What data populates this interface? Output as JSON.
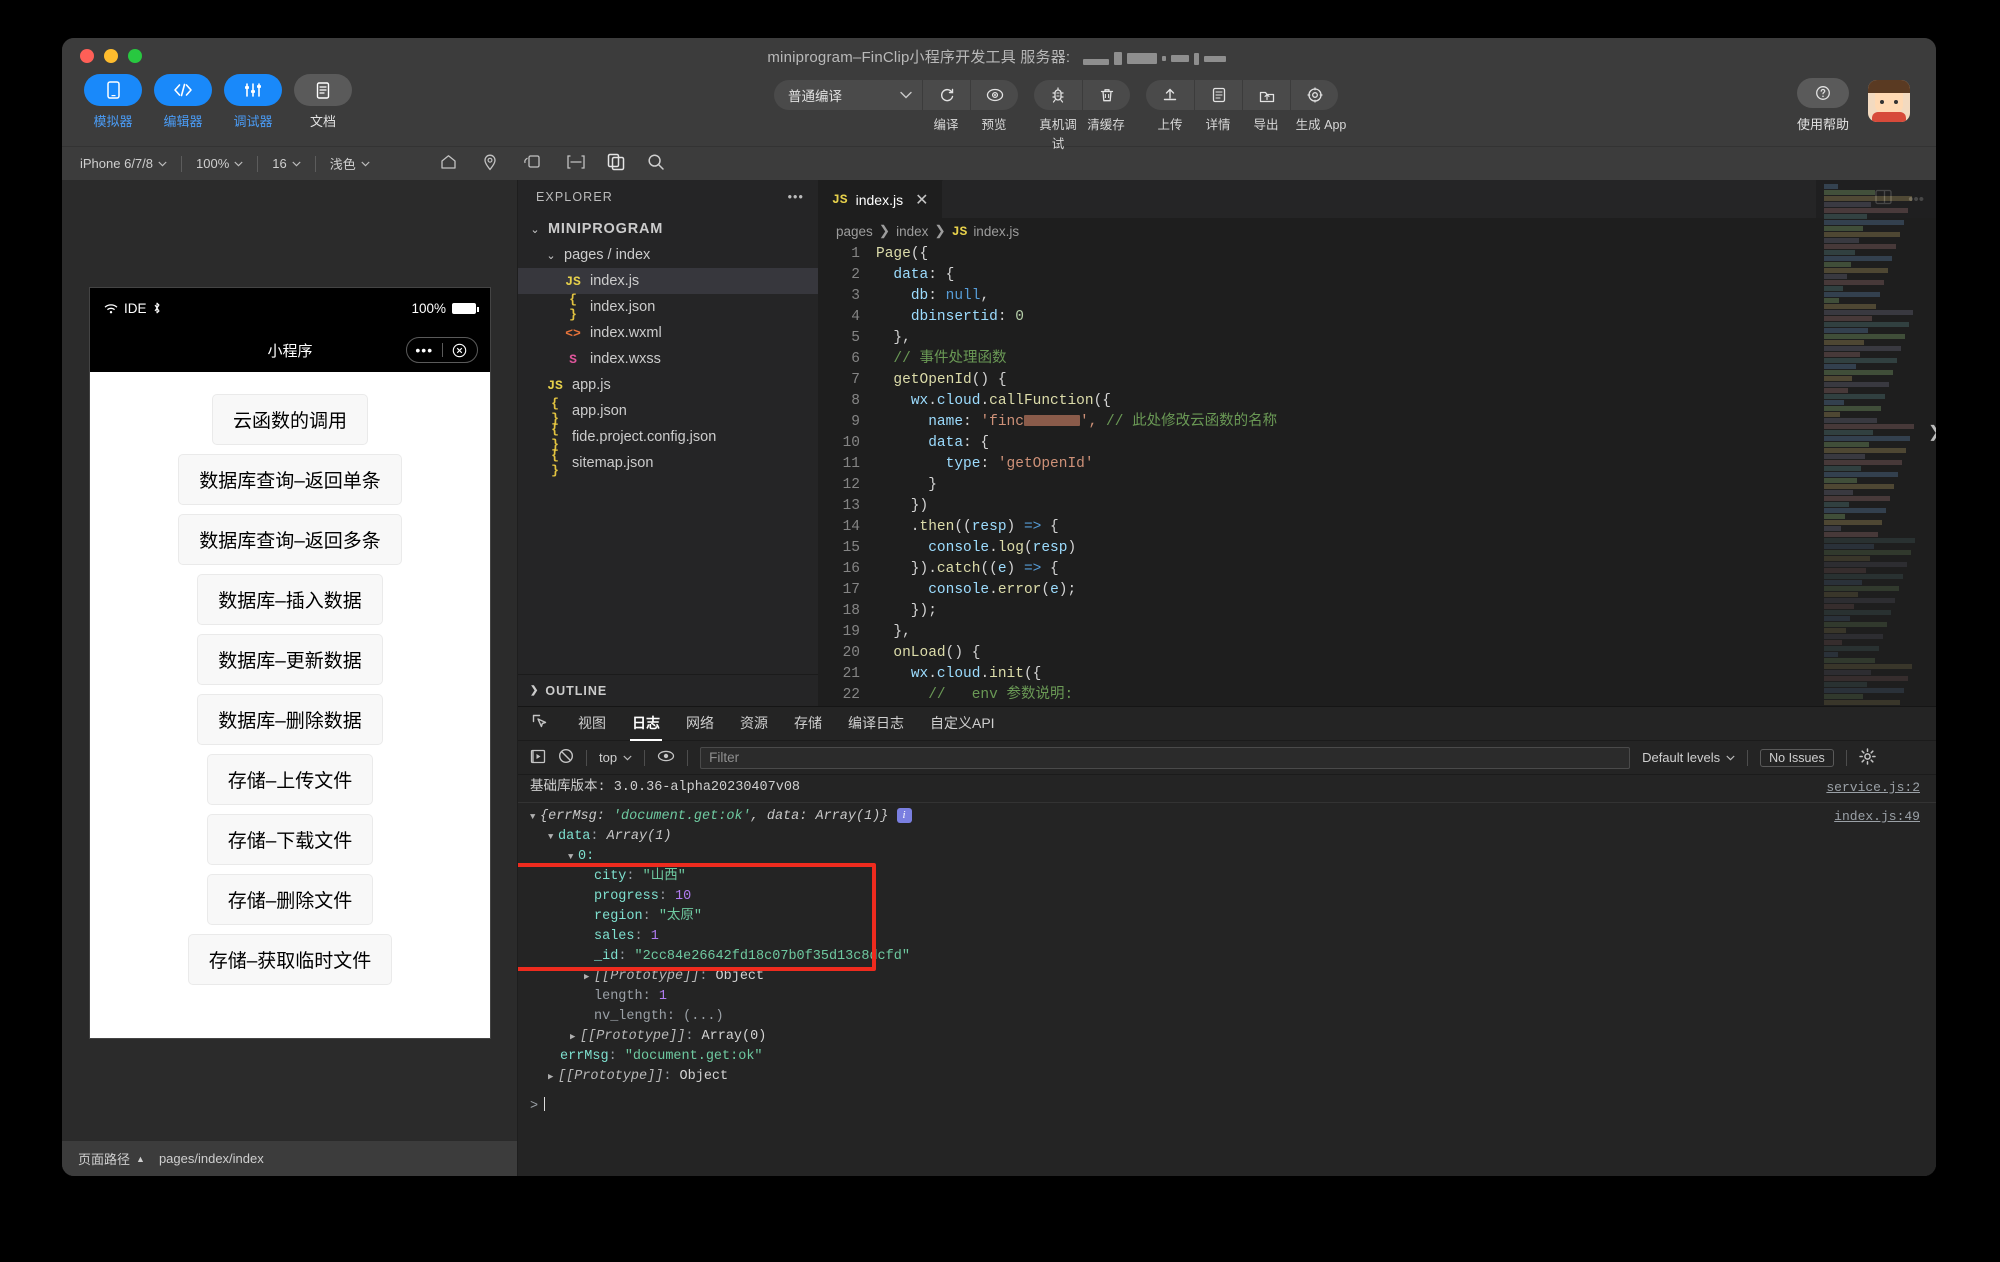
{
  "window": {
    "title": "miniprogram–FinClip小程序开发工具 服务器:",
    "redacted": true
  },
  "mode_tabs": [
    {
      "label": "模拟器",
      "icon": "phone-icon",
      "active": true
    },
    {
      "label": "编辑器",
      "icon": "code-icon",
      "active": true
    },
    {
      "label": "调试器",
      "icon": "sliders-icon",
      "active": true
    },
    {
      "label": "文档",
      "icon": "document-icon",
      "active": false
    }
  ],
  "toolbar": {
    "compile_mode": "普通编译",
    "actions": [
      {
        "label": "编译",
        "icon": "refresh-icon"
      },
      {
        "label": "预览",
        "icon": "eye-icon"
      },
      {
        "label": "真机调试",
        "icon": "bug-icon"
      },
      {
        "label": "清缓存",
        "icon": "trash-icon"
      },
      {
        "label": "上传",
        "icon": "upload-icon"
      },
      {
        "label": "详情",
        "icon": "info-doc-icon"
      },
      {
        "label": "导出",
        "icon": "export-icon"
      },
      {
        "label": "生成 App",
        "icon": "app-gear-icon"
      }
    ],
    "help_label": "使用帮助",
    "help_icon": "help-circle-icon"
  },
  "simulator_bar": {
    "device": "iPhone 6/7/8",
    "zoom": "100%",
    "font_size": "16",
    "theme": "浅色",
    "icons": [
      "home-icon",
      "location-icon",
      "rotate-icon",
      "fullscreen-icon",
      "copy-icon",
      "search-icon"
    ]
  },
  "phone": {
    "status_left": "IDE",
    "status_bluetooth": "bluetooth-icon",
    "battery_text": "100%",
    "nav_title": "小程序",
    "capsule_more": "•••",
    "capsule_close": "close-circle-icon",
    "buttons": [
      "云函数的调用",
      "数据库查询–返回单条",
      "数据库查询–返回多条",
      "数据库–插入数据",
      "数据库–更新数据",
      "数据库–删除数据",
      "存储–上传文件",
      "存储–下载文件",
      "存储–删除文件",
      "存储–获取临时文件"
    ]
  },
  "footer": {
    "label": "页面路径",
    "caret": "▲",
    "path": "pages/index/index"
  },
  "explorer": {
    "title": "EXPLORER",
    "more_icon": "ellipsis-icon",
    "root": "MINIPROGRAM",
    "folder": "pages / index",
    "files": [
      {
        "name": "index.js",
        "icon": "JS",
        "kind": "js",
        "selected": true
      },
      {
        "name": "index.json",
        "icon": "{ }",
        "kind": "json",
        "selected": false
      },
      {
        "name": "index.wxml",
        "icon": "<>",
        "kind": "wxml",
        "selected": false
      },
      {
        "name": "index.wxss",
        "icon": "S",
        "kind": "wxss",
        "selected": false
      },
      {
        "name": "app.js",
        "icon": "JS",
        "kind": "js",
        "selected": false
      },
      {
        "name": "app.json",
        "icon": "{ }",
        "kind": "json",
        "selected": false
      },
      {
        "name": "fide.project.config.json",
        "icon": "{ }",
        "kind": "json",
        "selected": false
      },
      {
        "name": "sitemap.json",
        "icon": "{ }",
        "kind": "json",
        "selected": false
      }
    ],
    "outline": "OUTLINE"
  },
  "editor": {
    "tab_label": "index.js",
    "tab_icon": "JS",
    "tab_close": "close-icon",
    "split_icon": "split-editor-icon",
    "more_icon": "ellipsis-icon",
    "breadcrumb": [
      "pages",
      "index",
      "index.js"
    ],
    "lines": [
      {
        "n": 1,
        "tokens": [
          {
            "t": "Page",
            "c": "fn"
          },
          {
            "t": "({",
            "c": "white"
          }
        ]
      },
      {
        "n": 2,
        "tokens": [
          {
            "t": "  ",
            "c": "white"
          },
          {
            "t": "data",
            "c": "key"
          },
          {
            "t": ": {",
            "c": "white"
          }
        ]
      },
      {
        "n": 3,
        "tokens": [
          {
            "t": "    ",
            "c": "white"
          },
          {
            "t": "db",
            "c": "key"
          },
          {
            "t": ": ",
            "c": "white"
          },
          {
            "t": "null",
            "c": "kw"
          },
          {
            "t": ",",
            "c": "white"
          }
        ]
      },
      {
        "n": 4,
        "tokens": [
          {
            "t": "    ",
            "c": "white"
          },
          {
            "t": "dbinsertid",
            "c": "key"
          },
          {
            "t": ": ",
            "c": "white"
          },
          {
            "t": "0",
            "c": "num"
          }
        ]
      },
      {
        "n": 5,
        "tokens": [
          {
            "t": "  },",
            "c": "white"
          }
        ]
      },
      {
        "n": 6,
        "tokens": [
          {
            "t": "  // 事件处理函数",
            "c": "com"
          }
        ]
      },
      {
        "n": 7,
        "tokens": [
          {
            "t": "  ",
            "c": "white"
          },
          {
            "t": "getOpenId",
            "c": "fn"
          },
          {
            "t": "() {",
            "c": "white"
          }
        ]
      },
      {
        "n": 8,
        "tokens": [
          {
            "t": "    ",
            "c": "white"
          },
          {
            "t": "wx",
            "c": "key"
          },
          {
            "t": ".",
            "c": "white"
          },
          {
            "t": "cloud",
            "c": "key"
          },
          {
            "t": ".",
            "c": "white"
          },
          {
            "t": "callFunction",
            "c": "fn"
          },
          {
            "t": "({",
            "c": "white"
          }
        ]
      },
      {
        "n": 9,
        "tokens": [
          {
            "t": "      ",
            "c": "white"
          },
          {
            "t": "name",
            "c": "key"
          },
          {
            "t": ": ",
            "c": "white"
          },
          {
            "t": "'finc",
            "c": "str"
          },
          {
            "t": "▆▄▅▃",
            "c": "redact"
          },
          {
            "t": "',",
            "c": "str"
          },
          {
            "t": " // 此处修改云函数的名称",
            "c": "com"
          }
        ]
      },
      {
        "n": 10,
        "tokens": [
          {
            "t": "      ",
            "c": "white"
          },
          {
            "t": "data",
            "c": "key"
          },
          {
            "t": ": {",
            "c": "white"
          }
        ]
      },
      {
        "n": 11,
        "tokens": [
          {
            "t": "        ",
            "c": "white"
          },
          {
            "t": "type",
            "c": "key"
          },
          {
            "t": ": ",
            "c": "white"
          },
          {
            "t": "'getOpenId'",
            "c": "str"
          }
        ]
      },
      {
        "n": 12,
        "tokens": [
          {
            "t": "      }",
            "c": "white"
          }
        ]
      },
      {
        "n": 13,
        "tokens": [
          {
            "t": "    })",
            "c": "white"
          }
        ]
      },
      {
        "n": 14,
        "tokens": [
          {
            "t": "    .",
            "c": "white"
          },
          {
            "t": "then",
            "c": "fn"
          },
          {
            "t": "((",
            "c": "white"
          },
          {
            "t": "resp",
            "c": "key"
          },
          {
            "t": ") ",
            "c": "white"
          },
          {
            "t": "=>",
            "c": "arrow"
          },
          {
            "t": " {",
            "c": "white"
          }
        ]
      },
      {
        "n": 15,
        "tokens": [
          {
            "t": "      ",
            "c": "white"
          },
          {
            "t": "console",
            "c": "key"
          },
          {
            "t": ".",
            "c": "white"
          },
          {
            "t": "log",
            "c": "fn"
          },
          {
            "t": "(",
            "c": "white"
          },
          {
            "t": "resp",
            "c": "key"
          },
          {
            "t": ")",
            "c": "white"
          }
        ]
      },
      {
        "n": 16,
        "tokens": [
          {
            "t": "    }).",
            "c": "white"
          },
          {
            "t": "catch",
            "c": "fn"
          },
          {
            "t": "((",
            "c": "white"
          },
          {
            "t": "e",
            "c": "key"
          },
          {
            "t": ") ",
            "c": "white"
          },
          {
            "t": "=>",
            "c": "arrow"
          },
          {
            "t": " {",
            "c": "white"
          }
        ]
      },
      {
        "n": 17,
        "tokens": [
          {
            "t": "      ",
            "c": "white"
          },
          {
            "t": "console",
            "c": "key"
          },
          {
            "t": ".",
            "c": "white"
          },
          {
            "t": "error",
            "c": "fn"
          },
          {
            "t": "(",
            "c": "white"
          },
          {
            "t": "e",
            "c": "key"
          },
          {
            "t": ");",
            "c": "white"
          }
        ]
      },
      {
        "n": 18,
        "tokens": [
          {
            "t": "    });",
            "c": "white"
          }
        ]
      },
      {
        "n": 19,
        "tokens": [
          {
            "t": "  },",
            "c": "white"
          }
        ]
      },
      {
        "n": 20,
        "tokens": [
          {
            "t": "  ",
            "c": "white"
          },
          {
            "t": "onLoad",
            "c": "fn"
          },
          {
            "t": "() {",
            "c": "white"
          }
        ]
      },
      {
        "n": 21,
        "tokens": [
          {
            "t": "    ",
            "c": "white"
          },
          {
            "t": "wx",
            "c": "key"
          },
          {
            "t": ".",
            "c": "white"
          },
          {
            "t": "cloud",
            "c": "key"
          },
          {
            "t": ".",
            "c": "white"
          },
          {
            "t": "init",
            "c": "fn"
          },
          {
            "t": "({",
            "c": "white"
          }
        ]
      },
      {
        "n": 22,
        "tokens": [
          {
            "t": "      //   env 参数说明:",
            "c": "com"
          }
        ]
      }
    ]
  },
  "console": {
    "tabs": [
      {
        "label": "视图",
        "active": false
      },
      {
        "label": "日志",
        "active": true
      },
      {
        "label": "网络",
        "active": false
      },
      {
        "label": "资源",
        "active": false
      },
      {
        "label": "存储",
        "active": false
      },
      {
        "label": "编译日志",
        "active": false
      },
      {
        "label": "自定义API",
        "active": false
      }
    ],
    "inspect_icon": "inspect-icon",
    "bar": {
      "run_icon": "run-icon",
      "clear_icon": "clear-icon",
      "context": "top",
      "eye_icon": "eye-icon",
      "filter_placeholder": "Filter",
      "levels": "Default levels",
      "issues": "No Issues",
      "settings_icon": "gear-icon"
    },
    "base_version_line": "基础库版本: 3.0.36-alpha20230407v08",
    "sources": {
      "service": "service.js:2",
      "index": "index.js:49"
    },
    "log": {
      "summary_prefix": "{errMsg: ",
      "summary_str": "'document.get:ok'",
      "summary_mid": ", data: ",
      "summary_arr": "Array(1)",
      "summary_suffix": "}",
      "badge": "i",
      "data_label": "data",
      "data_value": "Array(1)",
      "index_label": "0:",
      "fields": [
        {
          "key": "city",
          "value": "\"山西\"",
          "type": "string"
        },
        {
          "key": "progress",
          "value": "10",
          "type": "number"
        },
        {
          "key": "region",
          "value": "\"太原\"",
          "type": "string"
        },
        {
          "key": "sales",
          "value": "1",
          "type": "number"
        },
        {
          "key": "_id",
          "value": "\"2cc84e26642fd18c07b0f35d13c8dcfd\"",
          "type": "string"
        }
      ],
      "proto_1": "[[Prototype]]",
      "proto_1_val": "Object",
      "length_key": "length",
      "length_val": "1",
      "nvlength_key": "nv_length",
      "nvlength_val": "(...)",
      "proto_2": "[[Prototype]]",
      "proto_2_val": "Array(0)",
      "errmsg_key": "errMsg",
      "errmsg_val": "\"document.get:ok\"",
      "proto_3": "[[Prototype]]",
      "proto_3_val": "Object",
      "prompt": ">"
    },
    "highlight_color": "#ee2b1e"
  }
}
